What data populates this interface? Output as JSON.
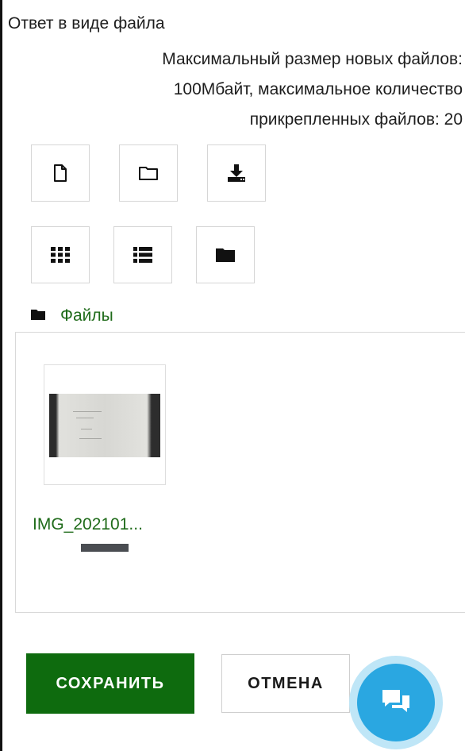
{
  "field": {
    "title": "Ответ в виде файла",
    "limits": [
      "Максимальный размер новых файлов:",
      "100Мбайт, максимальное количество",
      "прикрепленных файлов: 20"
    ]
  },
  "toolbar": {
    "row1": [
      "add-file-icon",
      "create-folder-icon",
      "download-icon"
    ],
    "row2": [
      "view-icons-icon",
      "view-list-icon",
      "view-tree-icon"
    ]
  },
  "path": {
    "label": "Файлы"
  },
  "files": [
    {
      "name": "IMG_202101..."
    }
  ],
  "actions": {
    "save_label": "СОХРАНИТЬ",
    "cancel_label": "ОТМЕНА"
  },
  "colors": {
    "primary": "#0e6b0e",
    "link": "#1f6b1a",
    "chat": "#2aa7e1"
  }
}
